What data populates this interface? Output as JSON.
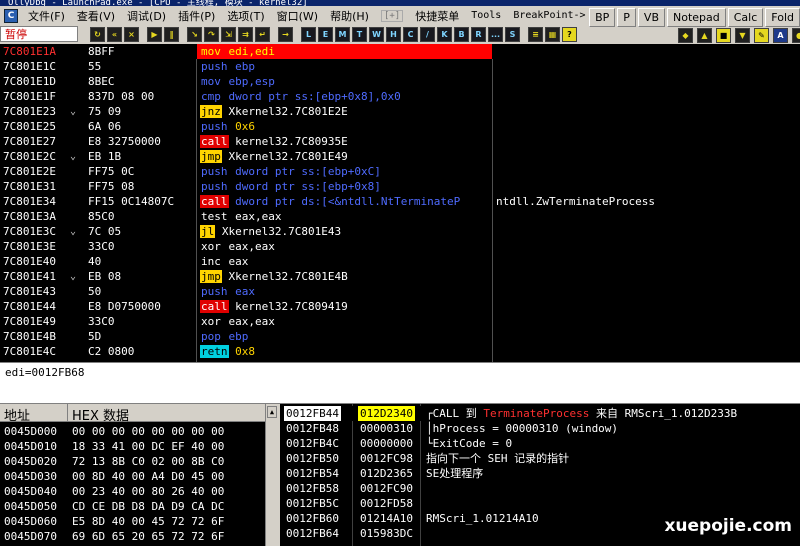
{
  "window": {
    "title": "OllyDbg - LaunchPad.exe - [CPU - 主线程, 模块 - kernel32]"
  },
  "menu": {
    "items": [
      "文件(F)",
      "查看(V)",
      "调试(D)",
      "插件(P)",
      "选项(T)",
      "窗口(W)",
      "帮助(H)"
    ],
    "plus": "[+]",
    "extra": [
      "快捷菜单",
      "Tools",
      "BreakPoint->"
    ]
  },
  "right_buttons": [
    "BP",
    "P",
    "VB",
    "Notepad",
    "Calc",
    "Fold"
  ],
  "toolbar": {
    "status": "暂停",
    "letters": [
      "L",
      "E",
      "M",
      "T",
      "W",
      "H",
      "C",
      "/",
      "K",
      "B",
      "R",
      "...",
      "S"
    ]
  },
  "cpu": {
    "rows": [
      {
        "addr": "7C801E1A",
        "arrow": "",
        "hex": "8BFF",
        "op": "mov",
        "op_style": "white",
        "args": "edi,edi",
        "arg_style": "yellow",
        "comment": "",
        "selected": true
      },
      {
        "addr": "7C801E1C",
        "arrow": "",
        "hex": "55",
        "op": "push",
        "op_style": "blue",
        "args": "ebp",
        "arg_style": "blue",
        "comment": ""
      },
      {
        "addr": "7C801E1D",
        "arrow": "",
        "hex": "8BEC",
        "op": "mov",
        "op_style": "blue",
        "args": "ebp,esp",
        "arg_style": "blue",
        "comment": ""
      },
      {
        "addr": "7C801E1F",
        "arrow": "",
        "hex": "837D 08 00",
        "op": "cmp",
        "op_style": "blue",
        "args": "dword ptr ss:[ebp+0x8],0x0",
        "arg_style": "blue",
        "comment": ""
      },
      {
        "addr": "7C801E23",
        "arrow": "⌄",
        "hex": "75 09",
        "op": "jnz",
        "op_style": "yellow",
        "args": "Xkernel32.7C801E2E",
        "arg_style": "white",
        "comment": ""
      },
      {
        "addr": "7C801E25",
        "arrow": "",
        "hex": "6A 06",
        "op": "push",
        "op_style": "blue",
        "args": "0x6",
        "arg_style": "yellow",
        "comment": ""
      },
      {
        "addr": "7C801E27",
        "arrow": "",
        "hex": "E8 32750000",
        "op": "call",
        "op_style": "red",
        "args": "kernel32.7C80935E",
        "arg_style": "white",
        "comment": ""
      },
      {
        "addr": "7C801E2C",
        "arrow": "⌄",
        "hex": "EB 1B",
        "op": "jmp",
        "op_style": "yellow",
        "args": "Xkernel32.7C801E49",
        "arg_style": "white",
        "comment": ""
      },
      {
        "addr": "7C801E2E",
        "arrow": "",
        "hex": "FF75 0C",
        "op": "push",
        "op_style": "blue",
        "args": "dword ptr ss:[ebp+0xC]",
        "arg_style": "blue",
        "comment": ""
      },
      {
        "addr": "7C801E31",
        "arrow": "",
        "hex": "FF75 08",
        "op": "push",
        "op_style": "blue",
        "args": "dword ptr ss:[ebp+0x8]",
        "arg_style": "blue",
        "comment": ""
      },
      {
        "addr": "7C801E34",
        "arrow": "",
        "hex": "FF15 0C14807C",
        "op": "call",
        "op_style": "red",
        "args": "dword ptr ds:[<&ntdll.NtTerminateP",
        "arg_style": "blue",
        "comment": "ntdll.ZwTerminateProcess"
      },
      {
        "addr": "7C801E3A",
        "arrow": "",
        "hex": "85C0",
        "op": "test",
        "op_style": "white",
        "args": "eax,eax",
        "arg_style": "white",
        "comment": ""
      },
      {
        "addr": "7C801E3C",
        "arrow": "⌄",
        "hex": "7C 05",
        "op": "jl",
        "op_style": "yellow",
        "args": "Xkernel32.7C801E43",
        "arg_style": "white",
        "comment": ""
      },
      {
        "addr": "7C801E3E",
        "arrow": "",
        "hex": "33C0",
        "op": "xor",
        "op_style": "white",
        "args": "eax,eax",
        "arg_style": "white",
        "comment": ""
      },
      {
        "addr": "7C801E40",
        "arrow": "",
        "hex": "40",
        "op": "inc",
        "op_style": "white",
        "args": "eax",
        "arg_style": "white",
        "comment": ""
      },
      {
        "addr": "7C801E41",
        "arrow": "⌄",
        "hex": "EB 08",
        "op": "jmp",
        "op_style": "yellow",
        "args": "Xkernel32.7C801E4B",
        "arg_style": "white",
        "comment": ""
      },
      {
        "addr": "7C801E43",
        "arrow": "",
        "hex": "50",
        "op": "push",
        "op_style": "blue",
        "args": "eax",
        "arg_style": "blue",
        "comment": ""
      },
      {
        "addr": "7C801E44",
        "arrow": "",
        "hex": "E8 D0750000",
        "op": "call",
        "op_style": "red",
        "args": "kernel32.7C809419",
        "arg_style": "white",
        "comment": ""
      },
      {
        "addr": "7C801E49",
        "arrow": "",
        "hex": "33C0",
        "op": "xor",
        "op_style": "white",
        "args": "eax,eax",
        "arg_style": "white",
        "comment": ""
      },
      {
        "addr": "7C801E4B",
        "arrow": "",
        "hex": "5D",
        "op": "pop",
        "op_style": "blue",
        "args": "ebp",
        "arg_style": "blue",
        "comment": ""
      },
      {
        "addr": "7C801E4C",
        "arrow": "",
        "hex": "C2 0800",
        "op": "retn",
        "op_style": "cyan",
        "args": "0x8",
        "arg_style": "yellow",
        "comment": ""
      }
    ]
  },
  "info_line": "edi=0012FB68",
  "dump": {
    "header_addr": "地址",
    "header_hex": "HEX 数据",
    "rows": [
      {
        "addr": "0045D000",
        "bytes": "00 00 00 00 00 00 00 00"
      },
      {
        "addr": "0045D010",
        "bytes": "18 33 41 00 DC EF 40 00"
      },
      {
        "addr": "0045D020",
        "bytes": "72 13 8B C0 02 00 8B C0"
      },
      {
        "addr": "0045D030",
        "bytes": "00 8D 40 00 A4 D0 45 00"
      },
      {
        "addr": "0045D040",
        "bytes": "00 23 40 00 80 26 40 00"
      },
      {
        "addr": "0045D050",
        "bytes": "CD CE DB D8 DA D9 CA DC"
      },
      {
        "addr": "0045D060",
        "bytes": "E5 8D 40 00 45 72 72 6F"
      },
      {
        "addr": "0045D070",
        "bytes": "69 6D 65 20 65 72 72 6F"
      }
    ]
  },
  "stack": {
    "rows": [
      {
        "addr": "0012FB44",
        "val": "012D2340",
        "comment_pre": "┌CALL 到 ",
        "comment_red": "TerminateProcess",
        "comment_post": " 来自 RMScri_1.012D233B",
        "selected": true
      },
      {
        "addr": "0012FB48",
        "val": "00000310",
        "comment_pre": "│hProcess = 00000310 (window)",
        "comment_red": "",
        "comment_post": ""
      },
      {
        "addr": "0012FB4C",
        "val": "00000000",
        "comment_pre": "└ExitCode = 0",
        "comment_red": "",
        "comment_post": ""
      },
      {
        "addr": "0012FB50",
        "val": "0012FC98",
        "comment_pre": "指向下一个 SEH 记录的指针",
        "comment_red": "",
        "comment_post": ""
      },
      {
        "addr": "0012FB54",
        "val": "012D2365",
        "comment_pre": "SE处理程序",
        "comment_red": "",
        "comment_post": ""
      },
      {
        "addr": "0012FB58",
        "val": "0012FC90",
        "comment_pre": "",
        "comment_red": "",
        "comment_post": ""
      },
      {
        "addr": "0012FB5C",
        "val": "0012FD58",
        "comment_pre": "",
        "comment_red": "",
        "comment_post": ""
      },
      {
        "addr": "0012FB60",
        "val": "01214A10",
        "comment_pre": "RMScri_1.01214A10",
        "comment_red": "",
        "comment_post": ""
      },
      {
        "addr": "0012FB64",
        "val": "015983DC",
        "comment_pre": "",
        "comment_red": "",
        "comment_post": ""
      }
    ]
  },
  "watermark": "xuepojie.com"
}
